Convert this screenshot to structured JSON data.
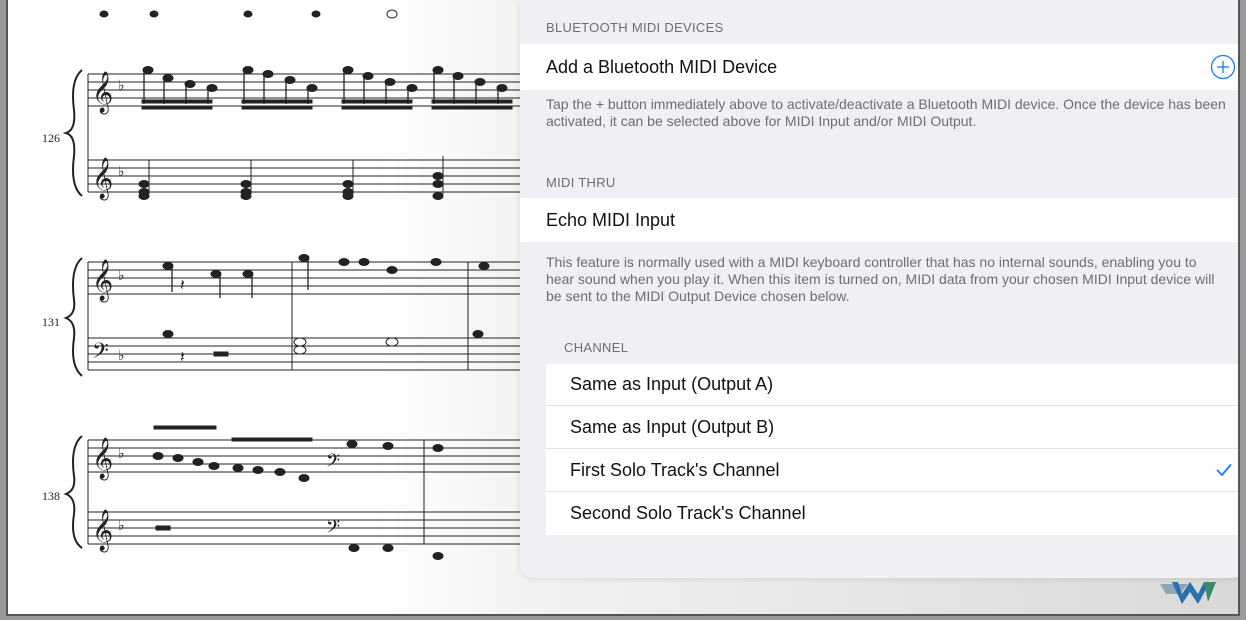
{
  "score": {
    "measure_numbers": [
      "126",
      "131",
      "138"
    ]
  },
  "panel": {
    "bluetooth": {
      "header": "BLUETOOTH MIDI DEVICES",
      "add_label": "Add a Bluetooth MIDI Device",
      "add_icon": "plus-circle-icon",
      "footer": "Tap the + button immediately above to activate/deactivate a Bluetooth MIDI device. Once the device has been activated, it can be selected above for MIDI Input and/or MIDI Output."
    },
    "midi_thru": {
      "header": "MIDI THRU",
      "echo_label": "Echo MIDI Input",
      "footer": "This feature is normally used with a MIDI keyboard controller that has no internal sounds, enabling you to hear sound when you play it. When this item is turned on, MIDI data from your chosen MIDI Input device will be sent to the MIDI Output Device chosen below."
    },
    "channel": {
      "header": "CHANNEL",
      "options": [
        {
          "label": "Same as Input (Output A)",
          "selected": false
        },
        {
          "label": "Same as Input (Output B)",
          "selected": false
        },
        {
          "label": "First Solo Track's Channel",
          "selected": true
        },
        {
          "label": "Second Solo Track's Channel",
          "selected": false
        }
      ]
    }
  },
  "colors": {
    "accent": "#1a7cf5",
    "panel_bg": "#efeff4",
    "secondary_text": "#6d6d72"
  }
}
